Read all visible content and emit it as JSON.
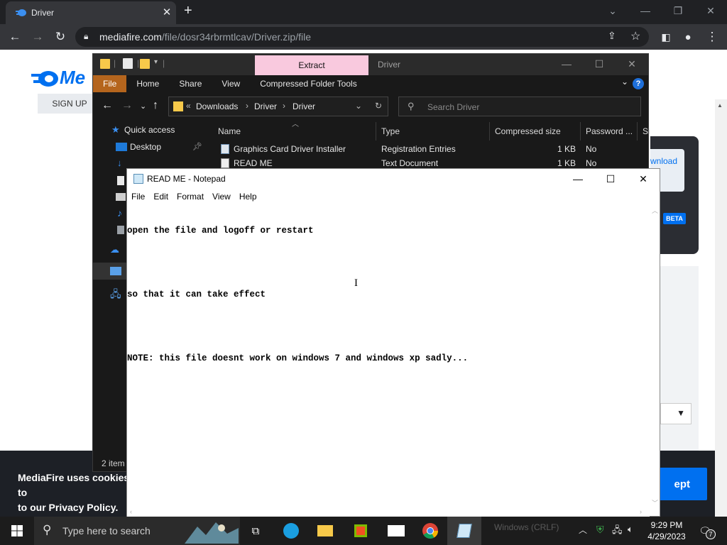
{
  "browser": {
    "tab_title": "Driver",
    "url_host": "mediafire.com",
    "url_path": "/file/dosr34rbrmtlcav/Driver.zip/file"
  },
  "mediafire": {
    "logo_text": "Me",
    "signup_label": "SIGN UP",
    "download_label": "wnload",
    "beta_label": "BETA",
    "cookie_text_1": "MediaFire uses cookies to",
    "cookie_text_2": "to our Privacy Policy.",
    "accept_label": "ept"
  },
  "explorer": {
    "title": "Driver",
    "extract_tab": "Extract",
    "ribbon": [
      "File",
      "Home",
      "Share",
      "View",
      "Compressed Folder Tools"
    ],
    "breadcrumb": [
      "Downloads",
      "Driver",
      "Driver"
    ],
    "search_placeholder": "Search Driver",
    "nav": {
      "quick_access": "Quick access",
      "desktop": "Desktop"
    },
    "columns": [
      "Name",
      "Type",
      "Compressed size",
      "Password ...",
      "Si"
    ],
    "files": [
      {
        "name": "Graphics Card Driver Installer",
        "type": "Registration Entries",
        "size": "1 KB",
        "password": "No"
      },
      {
        "name": "READ ME",
        "type": "Text Document",
        "size": "1 KB",
        "password": "No"
      }
    ],
    "status": "2 item"
  },
  "notepad": {
    "title": "READ ME - Notepad",
    "menu": [
      "File",
      "Edit",
      "Format",
      "View",
      "Help"
    ],
    "lines": [
      "open the file and logoff or restart",
      "",
      "so that it can take effect",
      "",
      "NOTE: this file doesnt work on windows 7 and windows xp sadly..."
    ]
  },
  "taskbar": {
    "search_placeholder": "Type here to search",
    "bg_status": "Windows (CRLF)",
    "time": "9:29 PM",
    "date": "4/29/2023",
    "notification_count": "7"
  }
}
